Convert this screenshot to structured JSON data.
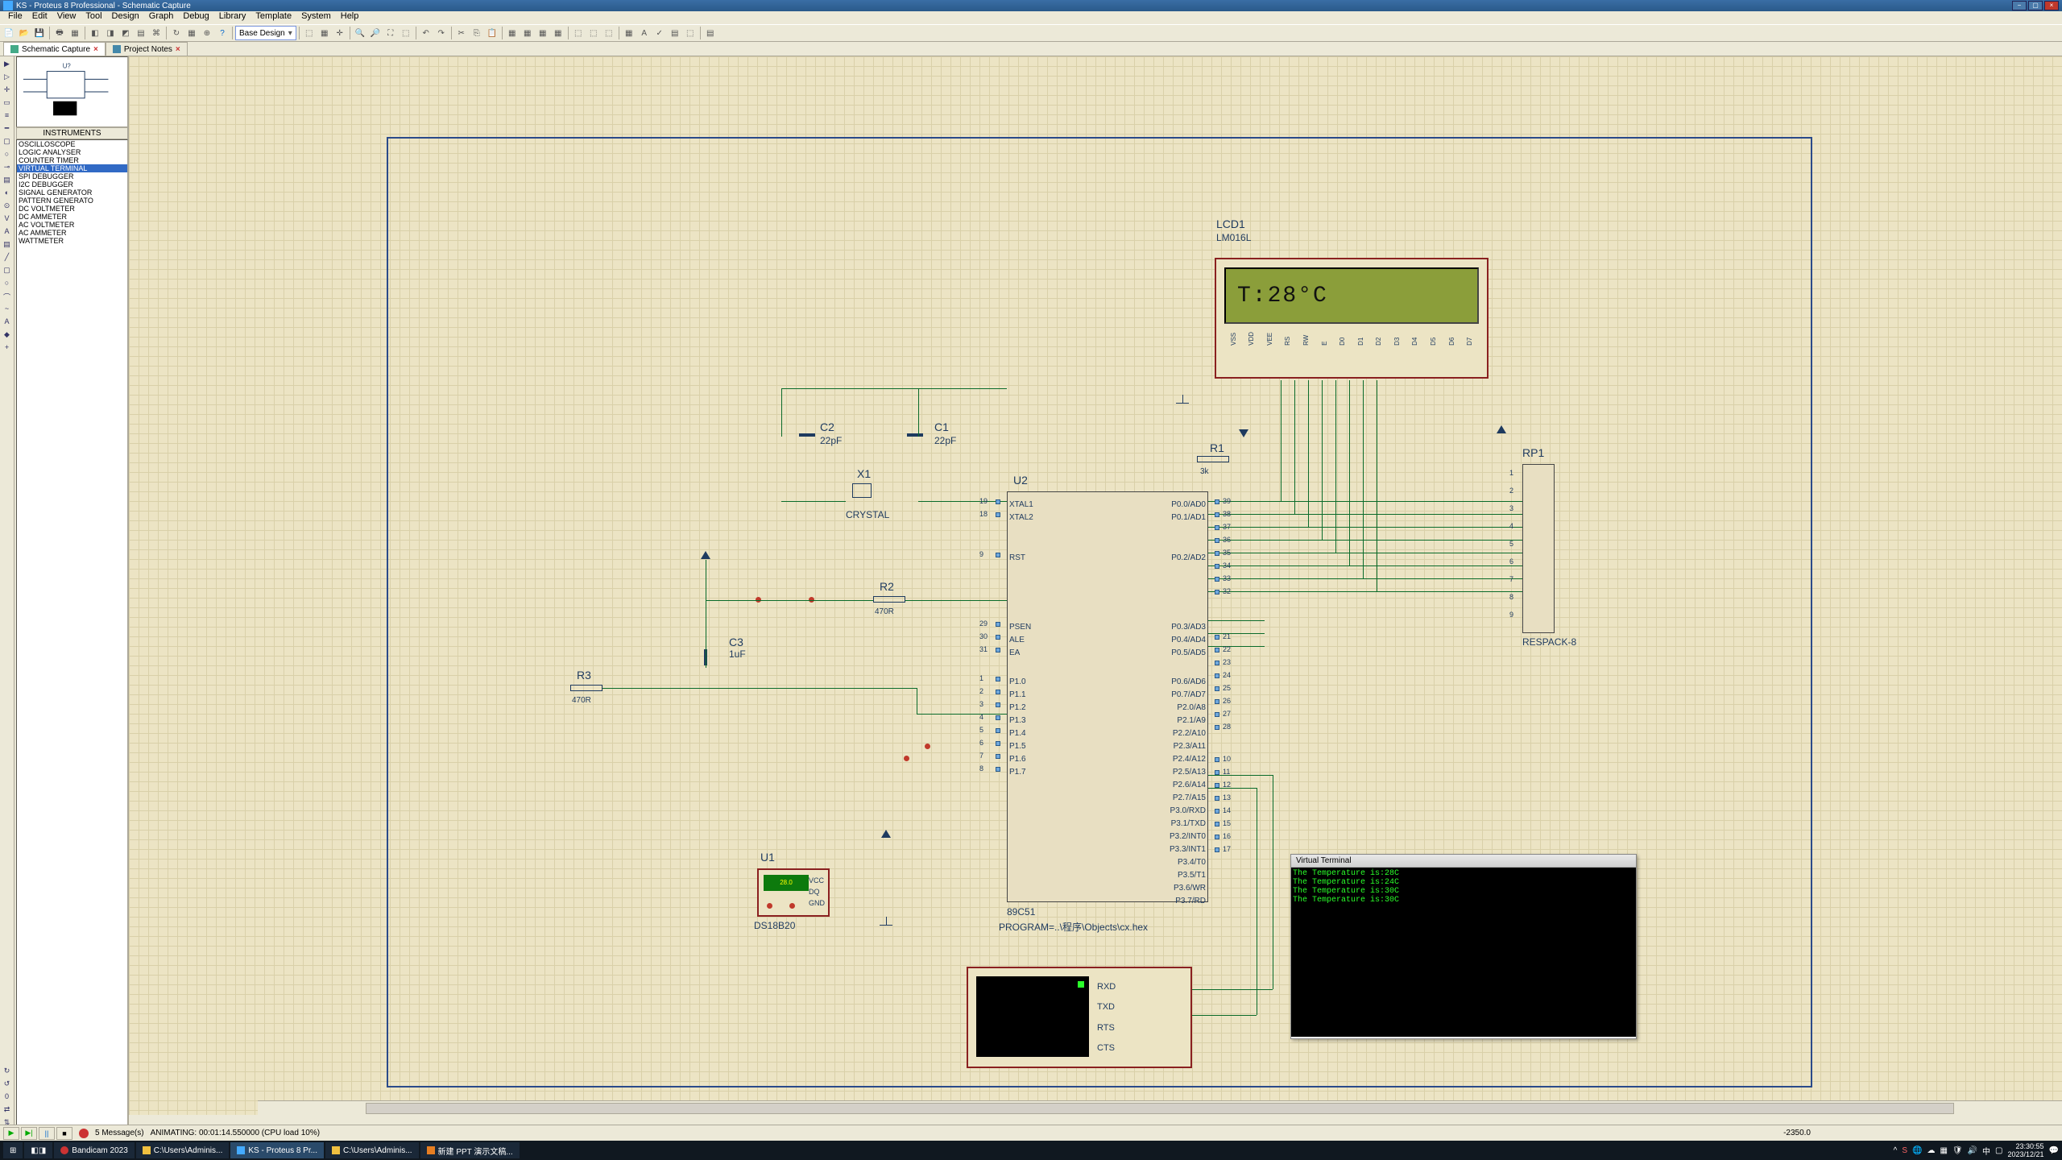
{
  "title": "KS - Proteus 8 Professional - Schematic Capture",
  "menus": [
    "File",
    "Edit",
    "View",
    "Tool",
    "Design",
    "Graph",
    "Debug",
    "Library",
    "Template",
    "System",
    "Help"
  ],
  "toolbarCombo": "Base Design",
  "tabs": [
    {
      "label": "Schematic Capture",
      "active": true
    },
    {
      "label": "Project Notes",
      "active": false
    }
  ],
  "instrumentsTitle": "INSTRUMENTS",
  "instruments": [
    "OSCILLOSCOPE",
    "LOGIC ANALYSER",
    "COUNTER TIMER",
    "VIRTUAL TERMINAL",
    "SPI DEBUGGER",
    "I2C DEBUGGER",
    "SIGNAL GENERATOR",
    "PATTERN GENERATO",
    "DC VOLTMETER",
    "DC AMMETER",
    "AC VOLTMETER",
    "AC AMMETER",
    "WATTMETER"
  ],
  "instrumentsSelected": "VIRTUAL TERMINAL",
  "lcd": {
    "ref": "LCD1",
    "part": "LM016L",
    "text": "T:28°C",
    "pins": [
      "VSS",
      "VDD",
      "VEE",
      "RS",
      "RW",
      "E",
      "D0",
      "D1",
      "D2",
      "D3",
      "D4",
      "D5",
      "D6",
      "D7"
    ]
  },
  "mcu": {
    "ref": "U2",
    "part": "89C51",
    "program": "PROGRAM=..\\程序\\Objects\\cx.hex",
    "left": [
      {
        "n": "19",
        "l": "XTAL1"
      },
      {
        "n": "18",
        "l": "XTAL2"
      },
      {
        "n": "9",
        "l": "RST"
      },
      {
        "n": "29",
        "l": "PSEN"
      },
      {
        "n": "30",
        "l": "ALE"
      },
      {
        "n": "31",
        "l": "EA"
      },
      {
        "n": "1",
        "l": "P1.0"
      },
      {
        "n": "2",
        "l": "P1.1"
      },
      {
        "n": "3",
        "l": "P1.2"
      },
      {
        "n": "4",
        "l": "P1.3"
      },
      {
        "n": "5",
        "l": "P1.4"
      },
      {
        "n": "6",
        "l": "P1.5"
      },
      {
        "n": "7",
        "l": "P1.6"
      },
      {
        "n": "8",
        "l": "P1.7"
      }
    ],
    "right": [
      {
        "n": "39",
        "l": "P0.0/AD0"
      },
      {
        "n": "38",
        "l": "P0.1/AD1"
      },
      {
        "n": "37",
        "l": "P0.2/AD2"
      },
      {
        "n": "36",
        "l": "P0.3/AD3"
      },
      {
        "n": "35",
        "l": "P0.4/AD4"
      },
      {
        "n": "34",
        "l": "P0.5/AD5"
      },
      {
        "n": "33",
        "l": "P0.6/AD6"
      },
      {
        "n": "32",
        "l": "P0.7/AD7"
      },
      {
        "n": "21",
        "l": "P2.0/A8"
      },
      {
        "n": "22",
        "l": "P2.1/A9"
      },
      {
        "n": "23",
        "l": "P2.2/A10"
      },
      {
        "n": "24",
        "l": "P2.3/A11"
      },
      {
        "n": "25",
        "l": "P2.4/A12"
      },
      {
        "n": "26",
        "l": "P2.5/A13"
      },
      {
        "n": "27",
        "l": "P2.6/A14"
      },
      {
        "n": "28",
        "l": "P2.7/A15"
      },
      {
        "n": "10",
        "l": "P3.0/RXD"
      },
      {
        "n": "11",
        "l": "P3.1/TXD"
      },
      {
        "n": "12",
        "l": "P3.2/INT0"
      },
      {
        "n": "13",
        "l": "P3.3/INT1"
      },
      {
        "n": "14",
        "l": "P3.4/T0"
      },
      {
        "n": "15",
        "l": "P3.5/T1"
      },
      {
        "n": "16",
        "l": "P3.6/WR"
      },
      {
        "n": "17",
        "l": "P3.7/RD"
      }
    ]
  },
  "rp1": {
    "ref": "RP1",
    "part": "RESPACK-8"
  },
  "r1": {
    "ref": "R1",
    "value": "3k"
  },
  "r2": {
    "ref": "R2",
    "value": "470R"
  },
  "r3": {
    "ref": "R3",
    "value": "470R"
  },
  "c1": {
    "ref": "C1",
    "value": "22pF"
  },
  "c2": {
    "ref": "C2",
    "value": "22pF"
  },
  "c3": {
    "ref": "C3",
    "value": "1uF"
  },
  "x1": {
    "ref": "X1",
    "value": "CRYSTAL"
  },
  "u1": {
    "ref": "U1",
    "part": "DS18B20",
    "temp": "28.0",
    "pins": [
      "VCC",
      "DQ",
      "GND"
    ]
  },
  "serterm": {
    "pins": [
      "RXD",
      "TXD",
      "RTS",
      "CTS"
    ]
  },
  "vt": {
    "title": "Virtual Terminal",
    "lines": [
      "The Temperature is:28C",
      "The Temperature is:24C",
      "The Temperature is:30C",
      "The Temperature is:30C"
    ]
  },
  "status": {
    "messages": "5 Message(s)",
    "anim": "ANIMATING: 00:01:14.550000 (CPU load 10%)",
    "coord": "-2350.0"
  },
  "taskbar": {
    "start": "⊞",
    "items": [
      {
        "label": "Bandicam 2023",
        "active": false
      },
      {
        "label": "C:\\Users\\Adminis...",
        "active": false
      },
      {
        "label": "KS - Proteus 8 Pr...",
        "active": true
      },
      {
        "label": "C:\\Users\\Adminis...",
        "active": false
      },
      {
        "label": "新建 PPT 演示文稿...",
        "active": false
      }
    ],
    "time": "23:30:55",
    "date": "2023/12/21"
  }
}
